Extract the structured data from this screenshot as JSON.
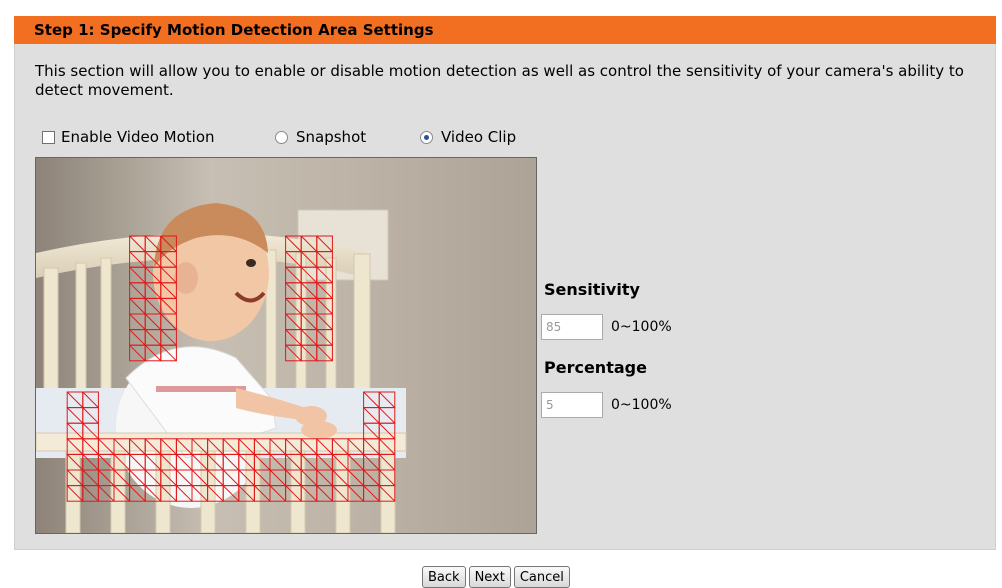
{
  "header": {
    "title": "Step 1: Specify Motion Detection Area Settings"
  },
  "description": "This section will allow you to enable or disable motion detection as well as control the sensitivity of your camera's ability to detect movement.",
  "options": {
    "enable_label": "Enable Video Motion",
    "enable_checked": false,
    "snapshot_label": "Snapshot",
    "videoclip_label": "Video Clip",
    "selected_mode": "Video Clip"
  },
  "preview": {
    "subject": "camera preview of baby in crib with red motion-detection grid overlay",
    "grid_color": "#e01818"
  },
  "sensitivity": {
    "label": "Sensitivity",
    "value": "85",
    "range": "0~100%"
  },
  "percentage": {
    "label": "Percentage",
    "value": "5",
    "range": "0~100%"
  },
  "buttons": {
    "back": "Back",
    "next": "Next",
    "cancel": "Cancel"
  },
  "colors": {
    "header": "#f26f21",
    "panel": "#dfdfdf"
  }
}
